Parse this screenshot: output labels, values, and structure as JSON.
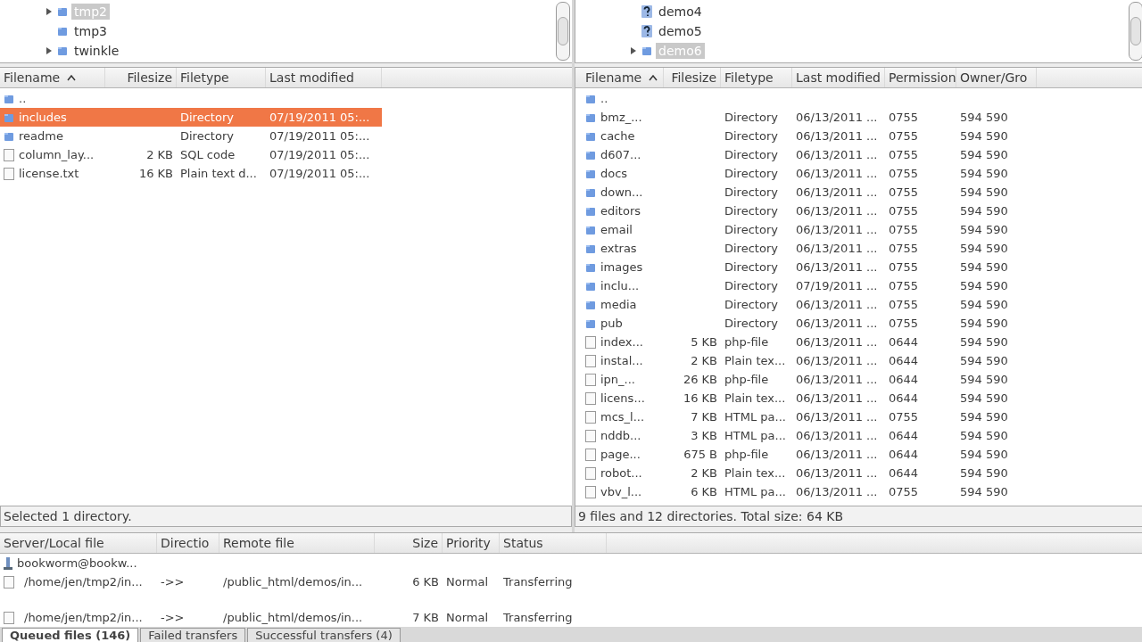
{
  "local": {
    "tree": [
      {
        "label": "tmp2",
        "kind": "folder",
        "expandable": true,
        "selected": true
      },
      {
        "label": "tmp3",
        "kind": "folder",
        "expandable": false,
        "selected": false
      },
      {
        "label": "twinkle",
        "kind": "folder",
        "expandable": true,
        "selected": false
      }
    ],
    "columns": [
      {
        "label": "Filename",
        "sorted": true
      },
      {
        "label": "Filesize",
        "sorted": false
      },
      {
        "label": "Filetype",
        "sorted": false
      },
      {
        "label": "Last modified",
        "sorted": false
      }
    ],
    "rows": [
      {
        "kind": "folder",
        "selected": false,
        "cells": [
          ".."
        ]
      },
      {
        "kind": "folder",
        "selected": true,
        "cells": [
          "includes",
          "",
          "Directory",
          "07/19/2011 05:..."
        ]
      },
      {
        "kind": "folder",
        "selected": false,
        "cells": [
          "readme",
          "",
          "Directory",
          "07/19/2011 05:..."
        ]
      },
      {
        "kind": "file",
        "selected": false,
        "cells": [
          "column_lay...",
          "2 KB",
          "SQL code",
          "07/19/2011 05:..."
        ]
      },
      {
        "kind": "file",
        "selected": false,
        "cells": [
          "license.txt",
          "16 KB",
          "Plain text d...",
          "07/19/2011 05:..."
        ]
      }
    ],
    "status": "Selected 1 directory."
  },
  "remote": {
    "tree": [
      {
        "label": "demo4",
        "kind": "unknown",
        "expandable": false,
        "selected": false
      },
      {
        "label": "demo5",
        "kind": "unknown",
        "expandable": false,
        "selected": false
      },
      {
        "label": "demo6",
        "kind": "folder",
        "expandable": true,
        "selected": true
      }
    ],
    "columns": [
      {
        "label": "Filename",
        "sorted": true
      },
      {
        "label": "Filesize",
        "sorted": false
      },
      {
        "label": "Filetype",
        "sorted": false
      },
      {
        "label": "Last modified",
        "sorted": false
      },
      {
        "label": "Permission",
        "sorted": false
      },
      {
        "label": "Owner/Gro",
        "sorted": false
      }
    ],
    "rows": [
      {
        "kind": "folder",
        "selected": false,
        "cells": [
          ".."
        ]
      },
      {
        "kind": "folder",
        "selected": false,
        "cells": [
          "bmz_...",
          "",
          "Directory",
          "06/13/2011 ...",
          "0755",
          "594 590"
        ]
      },
      {
        "kind": "folder",
        "selected": false,
        "cells": [
          "cache",
          "",
          "Directory",
          "06/13/2011 ...",
          "0755",
          "594 590"
        ]
      },
      {
        "kind": "folder",
        "selected": false,
        "cells": [
          "d607...",
          "",
          "Directory",
          "06/13/2011 ...",
          "0755",
          "594 590"
        ]
      },
      {
        "kind": "folder",
        "selected": false,
        "cells": [
          "docs",
          "",
          "Directory",
          "06/13/2011 ...",
          "0755",
          "594 590"
        ]
      },
      {
        "kind": "folder",
        "selected": false,
        "cells": [
          "down...",
          "",
          "Directory",
          "06/13/2011 ...",
          "0755",
          "594 590"
        ]
      },
      {
        "kind": "folder",
        "selected": false,
        "cells": [
          "editors",
          "",
          "Directory",
          "06/13/2011 ...",
          "0755",
          "594 590"
        ]
      },
      {
        "kind": "folder",
        "selected": false,
        "cells": [
          "email",
          "",
          "Directory",
          "06/13/2011 ...",
          "0755",
          "594 590"
        ]
      },
      {
        "kind": "folder",
        "selected": false,
        "cells": [
          "extras",
          "",
          "Directory",
          "06/13/2011 ...",
          "0755",
          "594 590"
        ]
      },
      {
        "kind": "folder",
        "selected": false,
        "cells": [
          "images",
          "",
          "Directory",
          "06/13/2011 ...",
          "0755",
          "594 590"
        ]
      },
      {
        "kind": "folder",
        "selected": false,
        "cells": [
          "inclu...",
          "",
          "Directory",
          "07/19/2011 ...",
          "0755",
          "594 590"
        ]
      },
      {
        "kind": "folder",
        "selected": false,
        "cells": [
          "media",
          "",
          "Directory",
          "06/13/2011 ...",
          "0755",
          "594 590"
        ]
      },
      {
        "kind": "folder",
        "selected": false,
        "cells": [
          "pub",
          "",
          "Directory",
          "06/13/2011 ...",
          "0755",
          "594 590"
        ]
      },
      {
        "kind": "file",
        "selected": false,
        "cells": [
          "index...",
          "5 KB",
          "php-file",
          "06/13/2011 ...",
          "0644",
          "594 590"
        ]
      },
      {
        "kind": "file",
        "selected": false,
        "cells": [
          "instal...",
          "2 KB",
          "Plain tex...",
          "06/13/2011 ...",
          "0644",
          "594 590"
        ]
      },
      {
        "kind": "file",
        "selected": false,
        "cells": [
          "ipn_...",
          "26 KB",
          "php-file",
          "06/13/2011 ...",
          "0644",
          "594 590"
        ]
      },
      {
        "kind": "file",
        "selected": false,
        "cells": [
          "licens...",
          "16 KB",
          "Plain tex...",
          "06/13/2011 ...",
          "0644",
          "594 590"
        ]
      },
      {
        "kind": "file",
        "selected": false,
        "cells": [
          "mcs_l...",
          "7 KB",
          "HTML pa...",
          "06/13/2011 ...",
          "0755",
          "594 590"
        ]
      },
      {
        "kind": "file",
        "selected": false,
        "cells": [
          "nddb...",
          "3 KB",
          "HTML pa...",
          "06/13/2011 ...",
          "0644",
          "594 590"
        ]
      },
      {
        "kind": "file",
        "selected": false,
        "cells": [
          "page...",
          "675 B",
          "php-file",
          "06/13/2011 ...",
          "0644",
          "594 590"
        ]
      },
      {
        "kind": "file",
        "selected": false,
        "cells": [
          "robot...",
          "2 KB",
          "Plain tex...",
          "06/13/2011 ...",
          "0644",
          "594 590"
        ]
      },
      {
        "kind": "file",
        "selected": false,
        "cells": [
          "vbv_l...",
          "6 KB",
          "HTML pa...",
          "06/13/2011 ...",
          "0755",
          "594 590"
        ]
      }
    ],
    "status": "9 files and 12 directories. Total size: 64 KB"
  },
  "queue": {
    "columns": [
      "Server/Local file",
      "Directio",
      "Remote file",
      "Size",
      "Priority",
      "Status"
    ],
    "rows": [
      {
        "kind": "server",
        "cells": [
          "bookworm@bookw..."
        ]
      },
      {
        "kind": "file",
        "cells": [
          "/home/jen/tmp2/in...",
          "->>",
          "/public_html/demos/in...",
          "6 KB",
          "Normal",
          "Transferring"
        ]
      },
      {
        "kind": "file",
        "cells": [
          "/home/jen/tmp2/in...",
          "->>",
          "/public_html/demos/in...",
          "7 KB",
          "Normal",
          "Transferring"
        ]
      }
    ],
    "tabs": [
      {
        "label": "Queued files (146)",
        "selected": true
      },
      {
        "label": "Failed transfers",
        "selected": false
      },
      {
        "label": "Successful transfers (4)",
        "selected": false
      }
    ]
  }
}
